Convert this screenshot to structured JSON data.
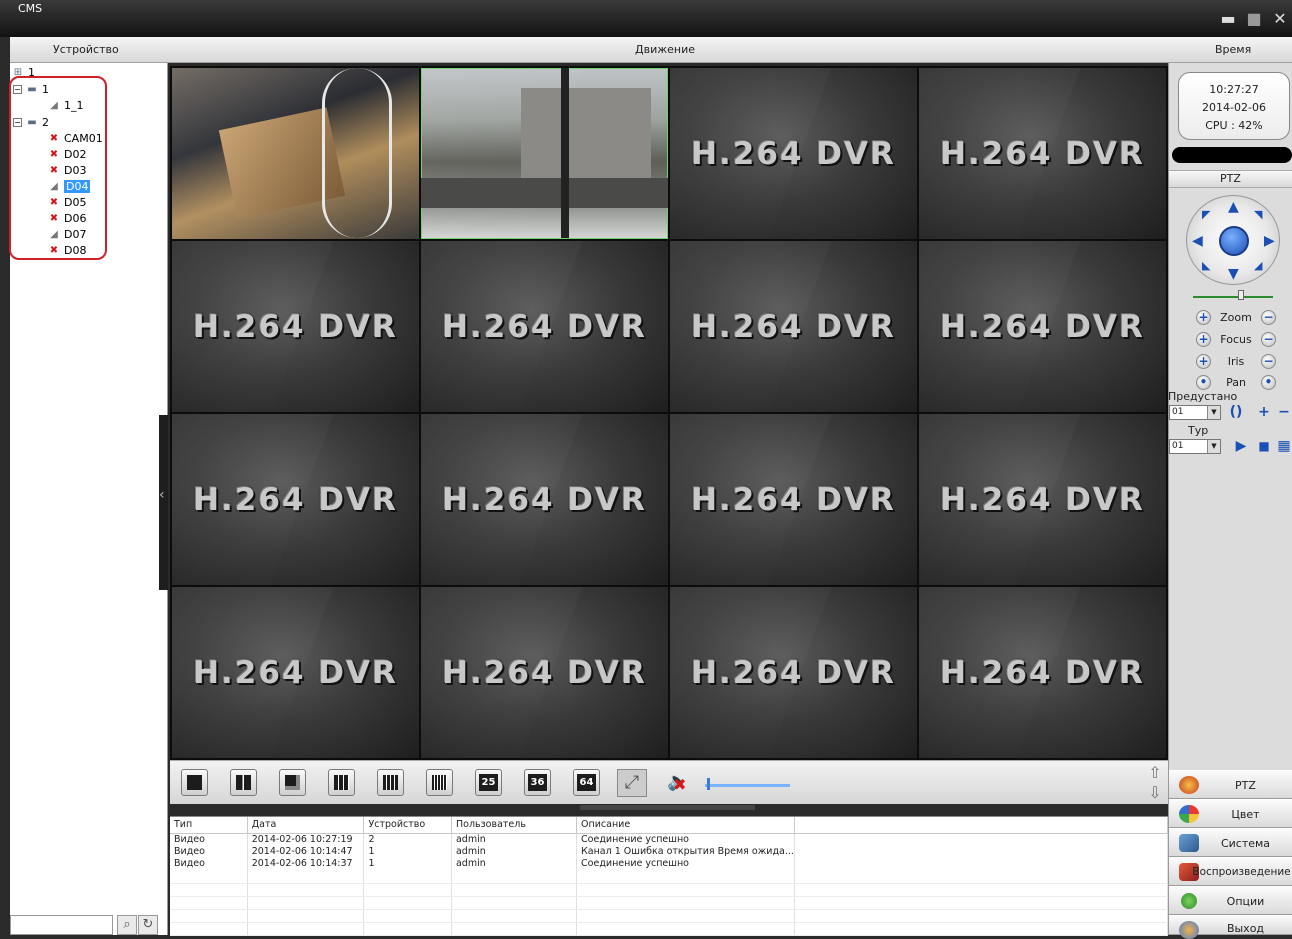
{
  "window": {
    "title": "CMS",
    "minimize": "▬",
    "maximize": "■",
    "close": "✕"
  },
  "header": {
    "device": "Устройство",
    "motion": "Движение",
    "time": "Время"
  },
  "tree": {
    "root": "1",
    "groups": [
      {
        "label": "1",
        "children": [
          {
            "label": "1_1",
            "status": "ok"
          }
        ]
      },
      {
        "label": "2",
        "children": [
          {
            "label": "CAM01",
            "status": "error"
          },
          {
            "label": "D02",
            "status": "error"
          },
          {
            "label": "D03",
            "status": "error"
          },
          {
            "label": "D04",
            "status": "ok",
            "selected": true
          },
          {
            "label": "D05",
            "status": "error"
          },
          {
            "label": "D06",
            "status": "error"
          },
          {
            "label": "D07",
            "status": "ok"
          },
          {
            "label": "D08",
            "status": "error"
          }
        ]
      }
    ]
  },
  "grid": {
    "logo_text": "H.264 DVR"
  },
  "toolbar": {
    "layouts": [
      "1",
      "4",
      "6",
      "9",
      "16",
      "16b",
      "25",
      "36",
      "64"
    ],
    "layout_labels": {
      "l25": "25",
      "l36": "36",
      "l64": "64"
    }
  },
  "log": {
    "columns": [
      "Тип",
      "Дата",
      "Устройство",
      "Пользователь",
      "Описание"
    ],
    "rows": [
      [
        "Видео",
        "2014-02-06 10:27:19",
        "2",
        "admin",
        "Соединение успешно"
      ],
      [
        "Видео",
        "2014-02-06 10:14:47",
        "1",
        "admin",
        "Канал 1 Ошибка открытия Время ожида..."
      ],
      [
        "Видео",
        "2014-02-06 10:14:37",
        "1",
        "admin",
        "Соединение успешно"
      ]
    ]
  },
  "status": {
    "time": "10:27:27",
    "date": "2014-02-06",
    "cpu": "CPU : 42%"
  },
  "ptz": {
    "title": "PTZ",
    "zoom": "Zoom",
    "focus": "Focus",
    "iris": "Iris",
    "pan": "Pan",
    "preset_label": "Предустано",
    "preset_value": "01",
    "tour_label": "Тур",
    "tour_value": "01"
  },
  "menu": {
    "ptz": "PTZ",
    "color": "Цвет",
    "system": "Система",
    "playback": "Воспроизведение",
    "options": "Опции",
    "exit": "Выход"
  },
  "colors": {
    "accent": "#1a4fb5",
    "selection": "#3399ff",
    "error": "#d21a1a",
    "highlight": "#d2202b"
  }
}
